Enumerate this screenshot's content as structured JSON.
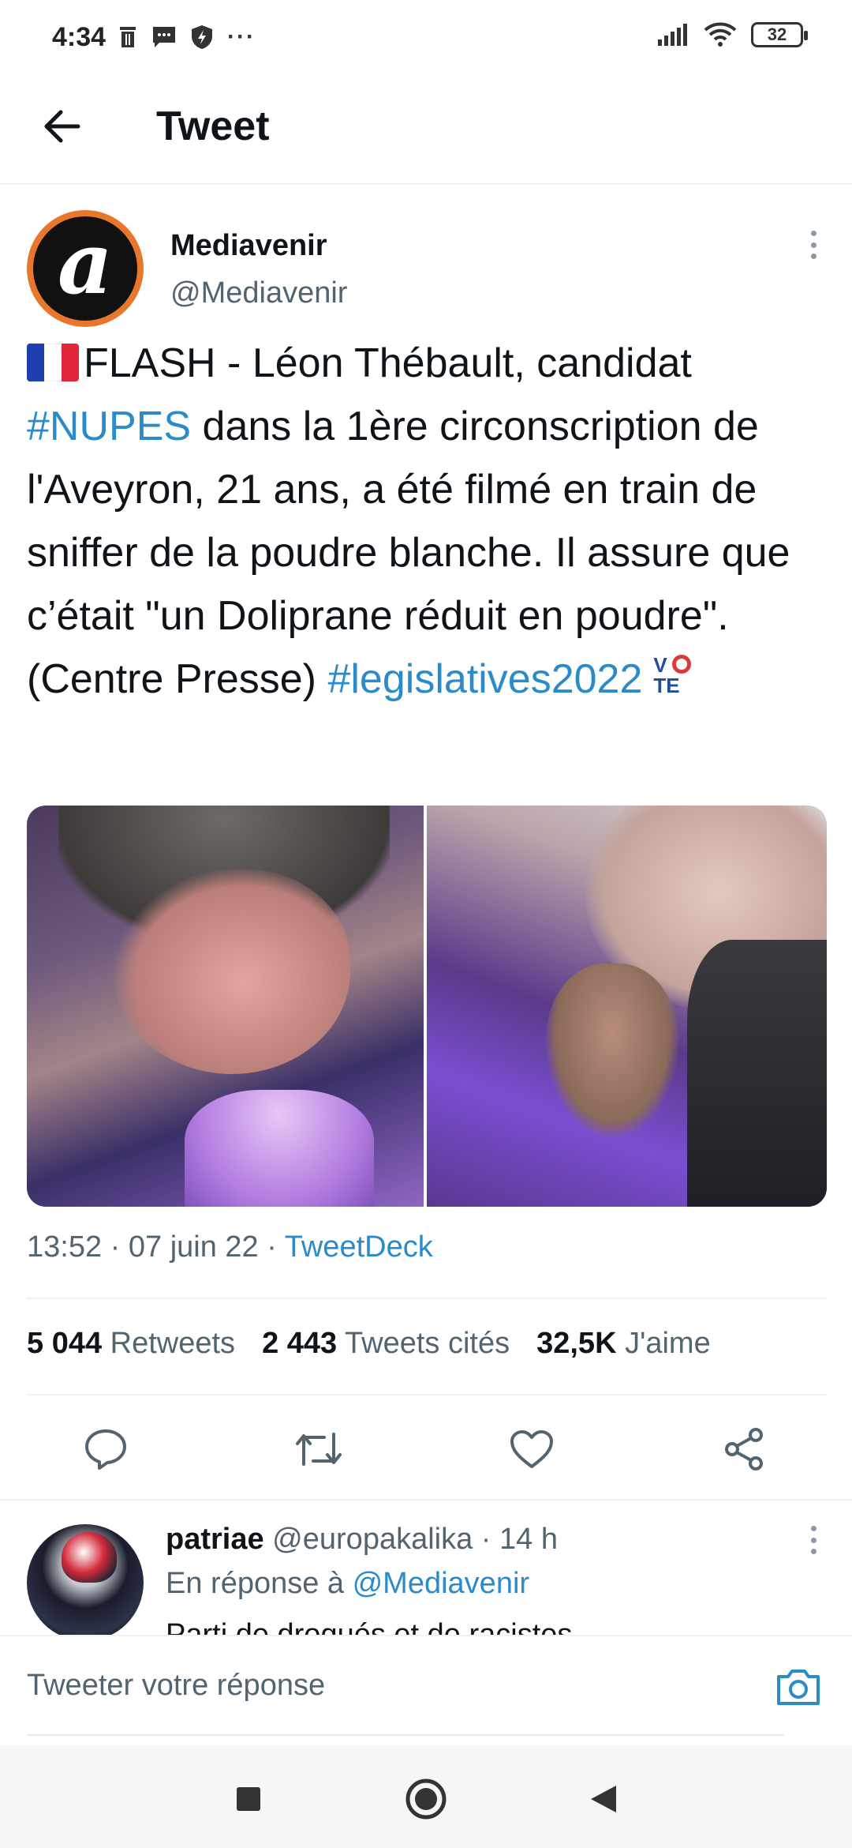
{
  "status_bar": {
    "time": "4:34",
    "battery": "32",
    "more": "···"
  },
  "header": {
    "title": "Tweet"
  },
  "tweet": {
    "author_name": "Mediavenir",
    "author_handle": "@Mediavenir",
    "text": {
      "part1": "FLASH - Léon Thébault, candidat ",
      "hashtag1": "#NUPES",
      "part2": " dans la 1ère circonscription de l'Aveyron, 21 ans, a été filmé en train de sniffer de la poudre blanche. Il assure que c’était \"un Doliprane réduit en poudre\". (Centre Presse) ",
      "hashtag2": "#legislatives2022"
    },
    "timestamp": "13:52 · 07 juin 22 · ",
    "source": "TweetDeck",
    "stats": {
      "retweets_count": "5 044",
      "retweets_label": "Retweets",
      "quotes_count": "2 443",
      "quotes_label": "Tweets cités",
      "likes_count": "32,5K",
      "likes_label": "J'aime"
    }
  },
  "reply": {
    "name": "patriae",
    "handle_time": " @europakalika · 14 h",
    "reply_to_prefix": "En réponse à ",
    "reply_to_mention": "@Mediavenir",
    "text": "Parti de drogués et de racistes"
  },
  "composer": {
    "placeholder": "Tweeter votre réponse"
  },
  "colors": {
    "link": "#2b8bc9",
    "muted": "#536471",
    "avatar_ring": "#e8772e"
  }
}
